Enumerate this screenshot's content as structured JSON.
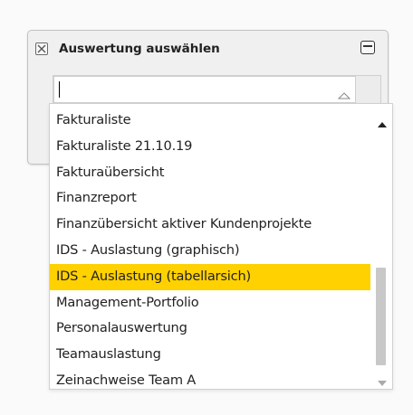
{
  "panel": {
    "title": "Auswertung auswählen",
    "close_icon": "close-icon",
    "window_icon": "window-toggle-icon"
  },
  "combo": {
    "value": "",
    "placeholder": "",
    "trigger_icon": "triangle-up-icon"
  },
  "dropdown": {
    "items": [
      {
        "label": "Fakturaliste"
      },
      {
        "label": "Fakturaliste 21.10.19"
      },
      {
        "label": "Fakturaübersicht"
      },
      {
        "label": "Finanzreport"
      },
      {
        "label": "Finanzübersicht aktiver Kundenprojekte"
      },
      {
        "label": "IDS - Auslastung (graphisch)"
      },
      {
        "label": "IDS - Auslastung (tabellarsich)"
      },
      {
        "label": "Management-Portfolio"
      },
      {
        "label": "Personalauswertung"
      },
      {
        "label": "Teamauslastung"
      },
      {
        "label": "Zeinachweise Team A"
      }
    ],
    "selected_index": 6,
    "highlight_color": "#ffd100",
    "scroll_position": 0.63
  }
}
